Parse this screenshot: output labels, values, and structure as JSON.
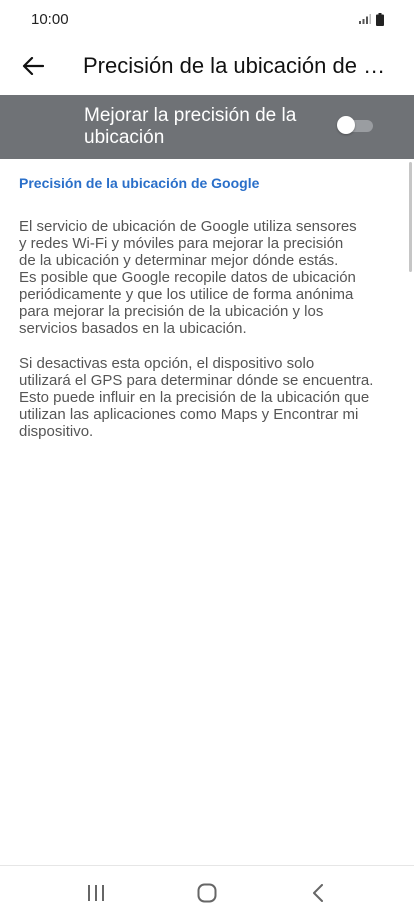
{
  "status_bar": {
    "time": "10:00"
  },
  "header": {
    "title": "Precisión de la ubicación de Google"
  },
  "master_switch": {
    "label": "Mejorar la precisión de la ubicación",
    "state": "off"
  },
  "content": {
    "section_title": "Precisión de la ubicación de Google",
    "paragraph_1": "El servicio de ubicación de Google utiliza sensores\ny redes Wi-Fi y móviles para mejorar la precisión\nde la ubicación y determinar mejor dónde estás.\nEs posible que Google recopile datos de ubicación\nperiódicamente y que los utilice de forma anónima\npara mejorar la precisión de la ubicación y los\nservicios basados en la ubicación.",
    "paragraph_2": "Si desactivas esta opción, el dispositivo solo\nutilizará el GPS para determinar dónde se encuentra.\nEsto puede influir en la precisión de la ubicación que\nutilizan las aplicaciones como Maps y Encontrar mi\ndispositivo."
  },
  "colors": {
    "accent_blue": "#2a6fc9",
    "banner_gray": "#6f7276"
  }
}
